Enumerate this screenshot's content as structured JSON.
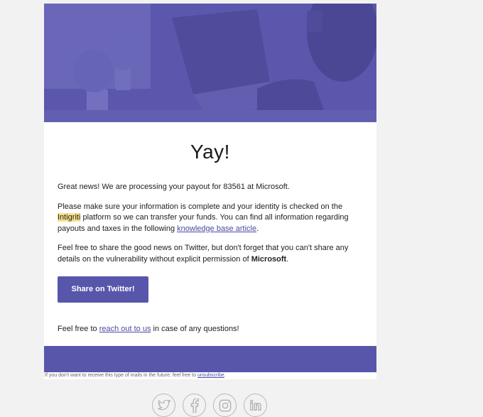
{
  "email": {
    "heading": "Yay!",
    "intro": "Great news! We are processing your payout for 83561 at Microsoft.",
    "info": {
      "part1": "Please make sure your information is complete and your identity is checked on the ",
      "brand": "Intigriti",
      "part2": " platform so we can transfer your funds. You can find all information regarding payouts and taxes in the following ",
      "link": "knowledge base article",
      "part3": "."
    },
    "share": {
      "part1": "Feel free to share the good news on Twitter, but don't forget that you can't share any details on the vulnerability without explicit permission of ",
      "company": "Microsoft",
      "part2": "."
    },
    "button_label": "Share on Twitter!",
    "closing": {
      "part1": "Feel free to ",
      "link": "reach out to us",
      "part2": " in case of any questions!"
    }
  },
  "footer": {
    "unsubscribe_text": "If you don't want to receive this type of mails in the future, feel free to ",
    "unsubscribe_link": "unsubscribe",
    "unsubscribe_end": "."
  },
  "social": [
    "twitter-icon",
    "facebook-icon",
    "instagram-icon",
    "linkedin-icon"
  ],
  "colors": {
    "accent": "#5856ab",
    "link": "#4b4aa3",
    "highlight": "#f6e08a",
    "background": "#f2f2f2"
  }
}
